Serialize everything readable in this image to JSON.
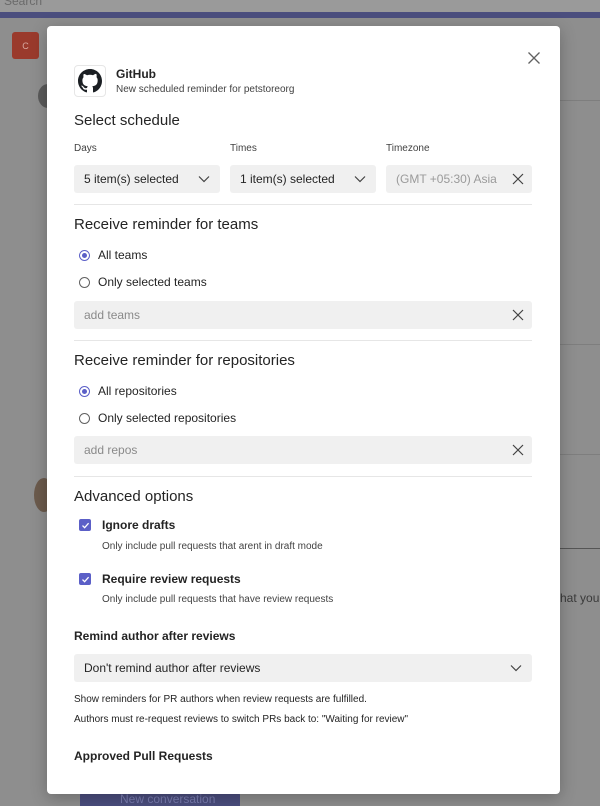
{
  "background": {
    "search_label": "Search",
    "badge_text": "C",
    "partial_text": "hat you",
    "new_conversation_label": "New conversation"
  },
  "header": {
    "app_name": "GitHub",
    "subtitle": "New scheduled reminder for petstoreorg"
  },
  "schedule": {
    "heading": "Select schedule",
    "days_label": "Days",
    "days_value": "5 item(s) selected",
    "times_label": "Times",
    "times_value": "1 item(s) selected",
    "timezone_label": "Timezone",
    "timezone_value": "(GMT +05:30) Asia"
  },
  "teams": {
    "heading": "Receive reminder for teams",
    "option_all": "All teams",
    "option_selected": "Only selected teams",
    "selected": "all",
    "input_placeholder": "add teams"
  },
  "repositories": {
    "heading": "Receive reminder for repositories",
    "option_all": "All repositories",
    "option_selected": "Only selected repositories",
    "selected": "all",
    "input_placeholder": "add repos"
  },
  "advanced": {
    "heading": "Advanced options",
    "ignore_drafts_label": "Ignore drafts",
    "ignore_drafts_checked": true,
    "ignore_drafts_desc": "Only include pull requests that arent in draft mode",
    "require_review_label": "Require review requests",
    "require_review_checked": true,
    "require_review_desc": "Only include pull requests that have review requests",
    "remind_author_heading": "Remind author after reviews",
    "remind_author_value": "Don't remind author after reviews",
    "note_1": "Show reminders for PR authors when review requests are fulfilled.",
    "note_2": "Authors must re-request reviews to switch PRs back to: \"Waiting for review\"",
    "approved_heading": "Approved Pull Requests"
  },
  "colors": {
    "accent": "#5b5fc7",
    "field_bg": "#f0f0f0",
    "overlay": "#8e8e8e"
  }
}
